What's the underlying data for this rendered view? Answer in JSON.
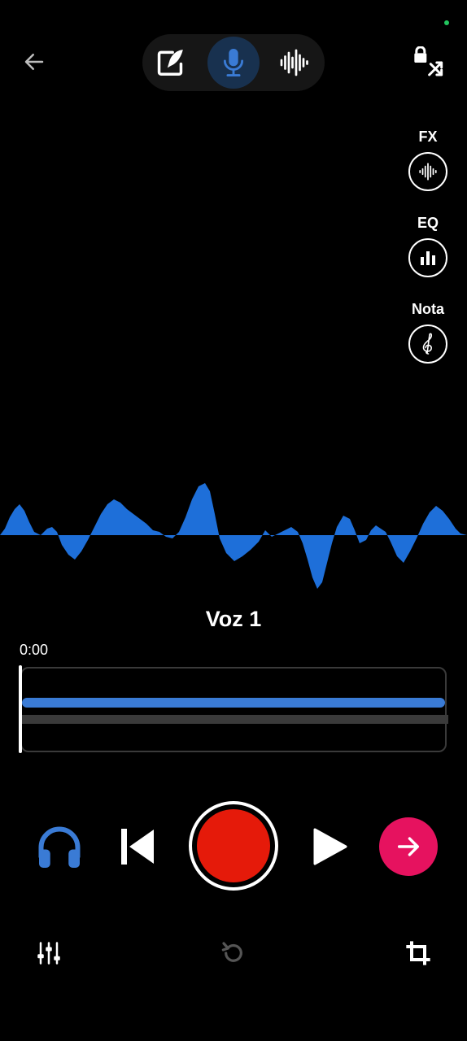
{
  "colors": {
    "background": "#000000",
    "accent_blue": "#3a7bd5",
    "record_red": "#e51a0a",
    "next_pink": "#e6125f",
    "status_green": "#22c55e"
  },
  "header": {
    "back_icon": "arrow-left-icon",
    "modes": [
      {
        "icon": "quill-write-icon",
        "selected": false
      },
      {
        "icon": "microphone-icon",
        "selected": true
      },
      {
        "icon": "waveform-icon",
        "selected": false
      }
    ],
    "lock_icon": "lock-shuffle-icon"
  },
  "side_tools": [
    {
      "label": "FX",
      "icon": "sound-wave-icon"
    },
    {
      "label": "EQ",
      "icon": "bar-chart-icon"
    },
    {
      "label": "Nota",
      "icon": "treble-clef-icon"
    }
  ],
  "track": {
    "name": "Voz 1",
    "time": "0:00",
    "progress": 0.0
  },
  "controls": {
    "headphones_icon": "headphones-icon",
    "prev_icon": "skip-previous-icon",
    "record_icon": "record-icon",
    "play_icon": "play-icon",
    "next_icon": "arrow-right-icon"
  },
  "bottom_bar": {
    "mixer_icon": "sliders-icon",
    "undo_icon": "undo-icon",
    "undo_enabled": false,
    "crop_icon": "crop-icon"
  }
}
